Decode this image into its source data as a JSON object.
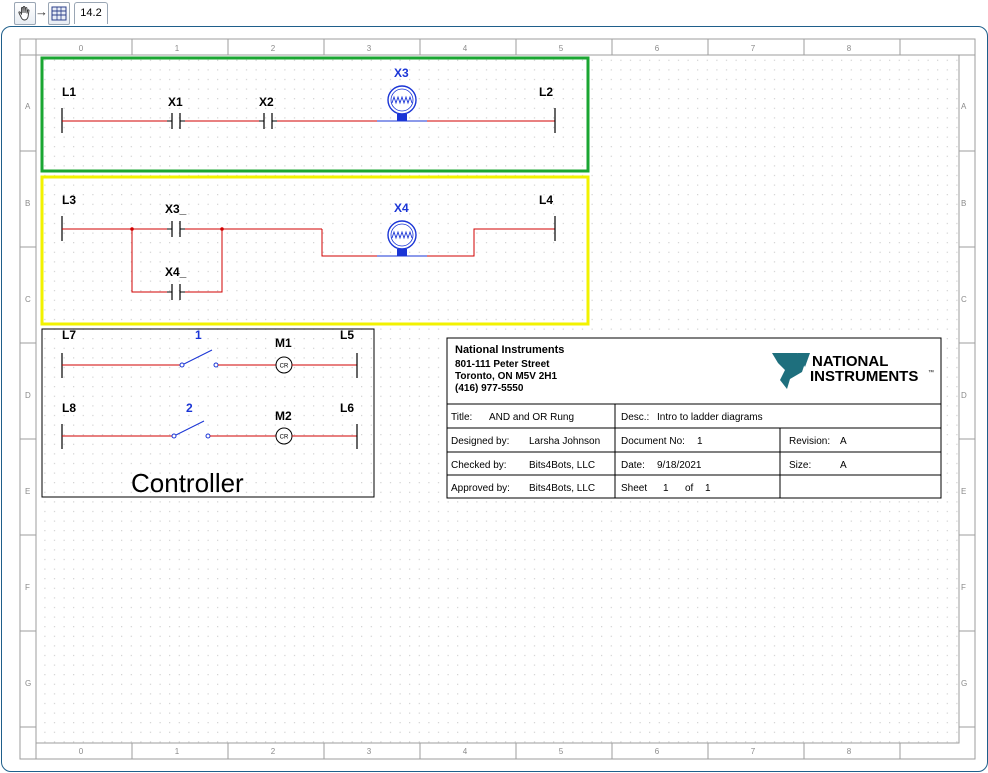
{
  "toolbar": {
    "pan_tool": "hand-icon",
    "arrow": "→",
    "circuit_tool": "circuit-icon",
    "zoom_value": "14.2"
  },
  "ruler": {
    "columns": [
      "0",
      "1",
      "2",
      "3",
      "4",
      "5",
      "6",
      "7",
      "8"
    ],
    "rows": [
      "A",
      "B",
      "C",
      "D",
      "E",
      "F",
      "G"
    ]
  },
  "rung1": {
    "left_rail": "L1",
    "right_rail": "L2",
    "contact1": "X1",
    "contact2": "X2",
    "lamp": "X3"
  },
  "rung2": {
    "left_rail": "L3",
    "right_rail": "L4",
    "contact1": "X3_",
    "contact2": "X4_",
    "lamp": "X4"
  },
  "controller": {
    "rail_l7": "L7",
    "rail_l5": "L5",
    "rail_l8": "L8",
    "rail_l6": "L6",
    "switch1": "1",
    "switch2": "2",
    "coil1": "M1",
    "coil2": "M2",
    "coil_symbol": "CR",
    "caption": "Controller"
  },
  "title_block": {
    "company": "National Instruments",
    "address1": "801-111 Peter Street",
    "address2": "Toronto, ON M5V 2H1",
    "phone": "(416) 977-5550",
    "logo_line1": "NATIONAL",
    "logo_line2": "INSTRUMENTS",
    "logo_tm": "™",
    "title_label": "Title:",
    "title_value": "AND and OR Rung",
    "desc_label": "Desc.:",
    "desc_value": "Intro to ladder diagrams",
    "designed_label": "Designed by:",
    "designed_value": "Larsha Johnson",
    "docno_label": "Document No:",
    "docno_value": "1",
    "revision_label": "Revision:",
    "revision_value": "A",
    "checked_label": "Checked by:",
    "checked_value": "Bits4Bots, LLC",
    "date_label": "Date:",
    "date_value": "9/18/2021",
    "size_label": "Size:",
    "size_value": "A",
    "approved_label": "Approved by:",
    "approved_value": "Bits4Bots, LLC",
    "sheet_label": "Sheet",
    "sheet_value": "1",
    "of_label": "of",
    "of_value": "1"
  },
  "colors": {
    "wire": "#d10000",
    "lamp": "#1a35d6",
    "and_box": "#1aa632",
    "or_box": "#f2f200",
    "frame": "#1f5f8b"
  }
}
